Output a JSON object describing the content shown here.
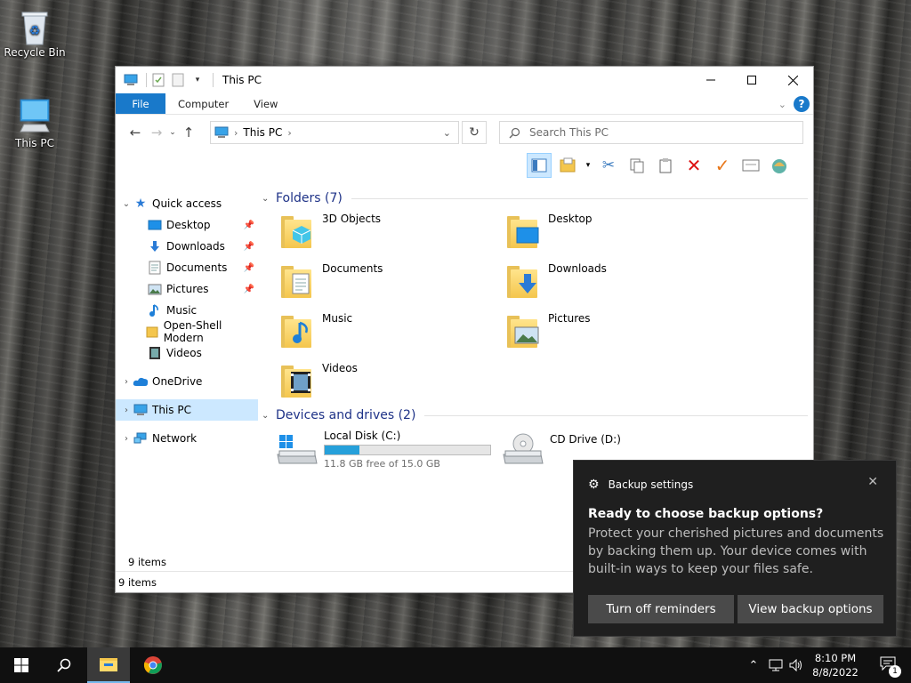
{
  "desktop": {
    "icons": [
      {
        "label": "Recycle Bin"
      },
      {
        "label": "This PC"
      }
    ]
  },
  "window": {
    "title": "This PC",
    "ribbon_tabs": [
      "File",
      "Computer",
      "View"
    ],
    "breadcrumb": [
      "This PC"
    ],
    "search_placeholder": "Search This PC",
    "nav_pane": {
      "quick_access": "Quick access",
      "quick_items": [
        {
          "label": "Desktop",
          "pinned": true
        },
        {
          "label": "Downloads",
          "pinned": true
        },
        {
          "label": "Documents",
          "pinned": true
        },
        {
          "label": "Pictures",
          "pinned": true
        },
        {
          "label": "Music",
          "pinned": false
        },
        {
          "label": "Open-Shell Modern",
          "pinned": false
        },
        {
          "label": "Videos",
          "pinned": false
        }
      ],
      "onedrive": "OneDrive",
      "this_pc": "This PC",
      "network": "Network"
    },
    "folders_header": "Folders (7)",
    "folders": [
      "3D Objects",
      "Desktop",
      "Documents",
      "Downloads",
      "Music",
      "Pictures",
      "Videos"
    ],
    "devices_header": "Devices and drives (2)",
    "devices": [
      {
        "name": "Local Disk (C:)",
        "free_text": "11.8 GB free of 15.0 GB",
        "used_fraction": 0.21
      },
      {
        "name": "CD Drive (D:)"
      }
    ],
    "items_count_inner": "9 items",
    "status_text": "9 items"
  },
  "toast": {
    "app": "Backup settings",
    "title": "Ready to choose backup options?",
    "body": "Protect your cherished pictures and documents by backing them up. Your device comes with built-in ways to keep your files safe.",
    "button1": "Turn off reminders",
    "button2": "View backup options"
  },
  "taskbar": {
    "time": "8:10 PM",
    "date": "8/8/2022",
    "notification_count": "1"
  },
  "colors": {
    "accent": "#1979ca",
    "folder_header": "#1e3287",
    "progress": "#26a0da",
    "selection": "#cce8ff"
  }
}
